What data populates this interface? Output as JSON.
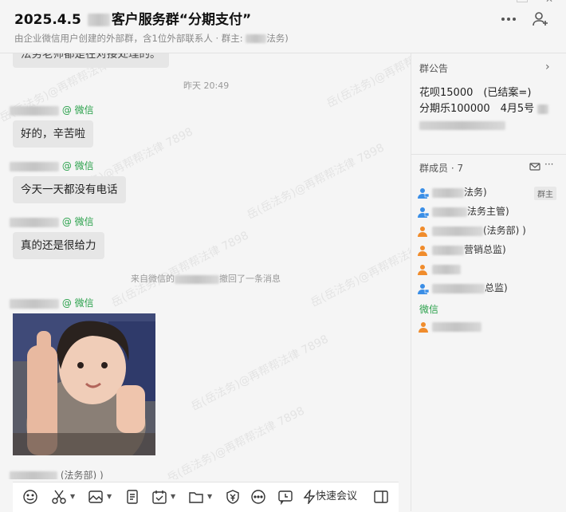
{
  "header": {
    "title_date": "2025.4.5",
    "title_rest": "客户服务群“分期支付”",
    "subtitle_prefix": "由企业微信用户创建的外部群，含1位外部联系人 · 群主:",
    "subtitle_suffix": "法务)"
  },
  "chat": {
    "partial_top_text": "法务老师都是在对接处理的。",
    "timestamp": "昨天 20:49",
    "wechat_tag": "@ 微信",
    "messages": [
      "好的，辛苦啦",
      "今天一天都没有电话",
      "真的还是很给力"
    ],
    "recall_prefix": "来自微信的",
    "recall_suffix": "撤回了一条消息",
    "last_sender_suffix": "(法务部) )",
    "watermark": "岳(岳法务)@再帮帮法律 7898"
  },
  "toolbar": {
    "meeting_label": "快速会议"
  },
  "sidebar": {
    "notice_title": "群公告",
    "notice_lines": [
      "花呗15000　(已结案=)",
      "分期乐100000　4月5号"
    ],
    "members_title": "群成员 · 7",
    "owner_badge": "群主",
    "wechat_section": "微信",
    "members": [
      {
        "label": "法务)",
        "color": "#3a8ee6"
      },
      {
        "label": "法务主管)",
        "color": "#3a8ee6"
      },
      {
        "label": "(法务部) )",
        "color": "#f08c2c"
      },
      {
        "label": "营销总监)",
        "color": "#f08c2c"
      },
      {
        "label": "",
        "color": "#f08c2c"
      },
      {
        "label": "总监)",
        "color": "#3a8ee6"
      }
    ],
    "wechat_member_color": "#f08c2c"
  }
}
